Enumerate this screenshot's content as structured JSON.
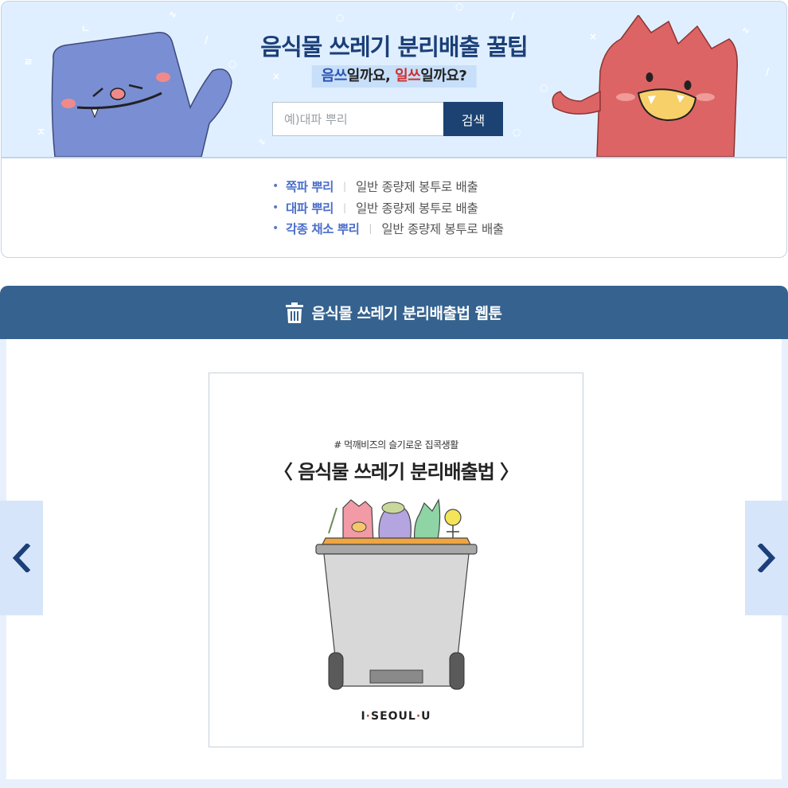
{
  "hero": {
    "title": "음식물 쓰레기 분리배출 꿀팁",
    "subtitle": {
      "part1": "음쓰",
      "part2": "일까요, ",
      "part3": "일쓰",
      "part4": "일까요?"
    }
  },
  "search": {
    "placeholder": "예)대파 뿌리",
    "button_label": "검색"
  },
  "results": [
    {
      "name": "쪽파 뿌리",
      "method": "일반 종량제 봉투로 배출"
    },
    {
      "name": "대파 뿌리",
      "method": "일반 종량제 봉투로 배출"
    },
    {
      "name": "각종 채소 뿌리",
      "method": "일반 종량제 봉투로 배출"
    }
  ],
  "webtoon": {
    "header_title": "음식물 쓰레기 분리배출법 웹툰",
    "header_icon": "trash-can-icon",
    "card": {
      "hashtag": "# 먹깨비즈의 슬기로운 집콕생활",
      "title": "〈 음식물 쓰레기 분리배출법 〉",
      "logo": {
        "part1": "I",
        "part2": "SEOUL",
        "part3": "U"
      }
    },
    "prev_icon": "chevron-left-icon",
    "next_icon": "chevron-right-icon"
  },
  "colors": {
    "hero_background": "#e0efff",
    "title_navy": "#1b3f78",
    "accent_blue": "#4c6fcb",
    "accent_red": "#cf2e2e",
    "header_blue": "#35628f",
    "search_button": "#1b4272",
    "nav_button": "#d6e5fa",
    "monster_left": "#7a8ed4",
    "monster_right": "#dd6464"
  }
}
